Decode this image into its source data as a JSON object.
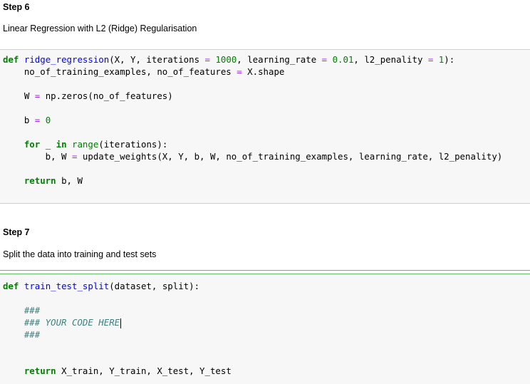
{
  "step6": {
    "title": "Step 6",
    "description": "Linear Regression with L2 (Ridge) Regularisation",
    "code": {
      "def_kw": "def",
      "fn_name": "ridge_regression",
      "sig_a": "(X, Y, iterations ",
      "eq1": "=",
      "sp1": " ",
      "iter_val": "1000",
      "sig_b": ", learning_rate ",
      "eq2": "=",
      "sp2": " ",
      "lr_val": "0.01",
      "sig_c": ", l2_penality ",
      "eq3": "=",
      "sp3": " ",
      "pen_val": "1",
      "sig_end": "):",
      "l2_a": "    no_of_training_examples, no_of_features ",
      "l2_eq": "=",
      "l2_b": " X.shape",
      "l3_a": "    W ",
      "l3_eq": "=",
      "l3_b": " np.zeros(no_of_features)",
      "l4_a": "    b ",
      "l4_eq": "=",
      "l4_sp": " ",
      "l4_num": "0",
      "l5_ind": "    ",
      "l5_for": "for",
      "l5_a": " _ ",
      "l5_in": "in",
      "l5_sp": " ",
      "l5_range": "range",
      "l5_b": "(iterations):",
      "l6_a": "        b, W ",
      "l6_eq": "=",
      "l6_b": " update_weights(X, Y, b, W, no_of_training_examples, learning_rate, l2_penality)",
      "l7_ind": "    ",
      "l7_ret": "return",
      "l7_b": " b, W"
    }
  },
  "step7": {
    "title": "Step 7",
    "description": "Split the data into training and test sets",
    "code": {
      "def_kw": "def",
      "fn_name": "train_test_split",
      "sig": "(dataset, split):",
      "c1": "    ###",
      "c2": "    ### YOUR CODE HERE",
      "c3": "    ###",
      "ret_ind": "    ",
      "ret_kw": "return",
      "ret_b": " X_train, Y_train, X_test, Y_test"
    }
  }
}
